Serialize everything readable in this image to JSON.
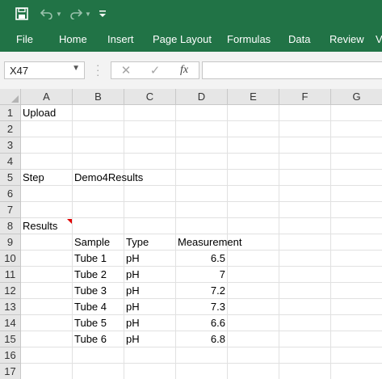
{
  "quick_access": {
    "save_icon": "save-icon",
    "undo_icon": "undo-icon",
    "redo_icon": "redo-icon",
    "customize_icon": "customize-icon"
  },
  "ribbon": {
    "tabs": [
      "File",
      "Home",
      "Insert",
      "Page Layout",
      "Formulas",
      "Data",
      "Review",
      "V"
    ],
    "accent_color": "#217346"
  },
  "formula_bar": {
    "name_box": "X47",
    "cancel_symbol": "✕",
    "enter_symbol": "✓",
    "fx_symbol": "fx",
    "formula": ""
  },
  "sheet": {
    "columns": [
      "A",
      "B",
      "C",
      "D",
      "E",
      "F",
      "G"
    ],
    "rows": [
      "1",
      "2",
      "3",
      "4",
      "5",
      "6",
      "7",
      "8",
      "9",
      "10",
      "11",
      "12",
      "13",
      "14",
      "15",
      "16",
      "17"
    ],
    "cells": {
      "A1": "Upload",
      "A5": "Step",
      "B5": "Demo4Results",
      "A8": "Results",
      "B9": "Sample",
      "C9": "Type",
      "D9": "Measurement",
      "B10": "Tube 1",
      "C10": "pH",
      "D10": "6.5",
      "B11": "Tube 2",
      "C11": "pH",
      "D11": "7",
      "B12": "Tube 3",
      "C12": "pH",
      "D12": "7.2",
      "B13": "Tube 4",
      "C13": "pH",
      "D13": "7.3",
      "B14": "Tube 5",
      "C14": "pH",
      "D14": "6.6",
      "B15": "Tube 6",
      "C15": "pH",
      "D15": "6.8"
    },
    "numeric_cells": [
      "D10",
      "D11",
      "D12",
      "D13",
      "D14",
      "D15"
    ],
    "commented_cells": [
      "A8"
    ]
  }
}
